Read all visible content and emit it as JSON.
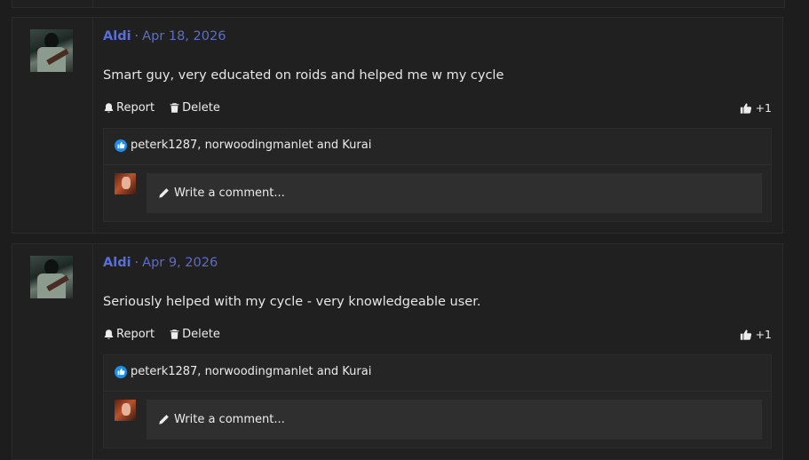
{
  "posts": [
    {
      "author": "Aldi",
      "separator": "·",
      "date": "Apr 18, 2026",
      "message": "Smart guy, very educated on roids and helped me w my cycle",
      "report_label": "Report",
      "delete_label": "Delete",
      "reaction_count": "+1",
      "reacted_by": "peterk1287, norwoodingmanlet and Kurai",
      "comment_placeholder": "Write a comment..."
    },
    {
      "author": "Aldi",
      "separator": "·",
      "date": "Apr 9, 2026",
      "message": "Seriously helped with my cycle - very knowledgeable user.",
      "report_label": "Report",
      "delete_label": "Delete",
      "reaction_count": "+1",
      "reacted_by": "peterk1287, norwoodingmanlet and Kurai",
      "comment_placeholder": "Write a comment..."
    }
  ],
  "colors": {
    "background": "#1d1d1d",
    "panel": "#202020",
    "author_link": "#5a6fd6",
    "like_badge": "#1f8ee8"
  },
  "icons": {
    "report": "bell-icon",
    "delete": "trash-icon",
    "like": "thumbs-up-icon",
    "comment": "pencil-icon"
  }
}
